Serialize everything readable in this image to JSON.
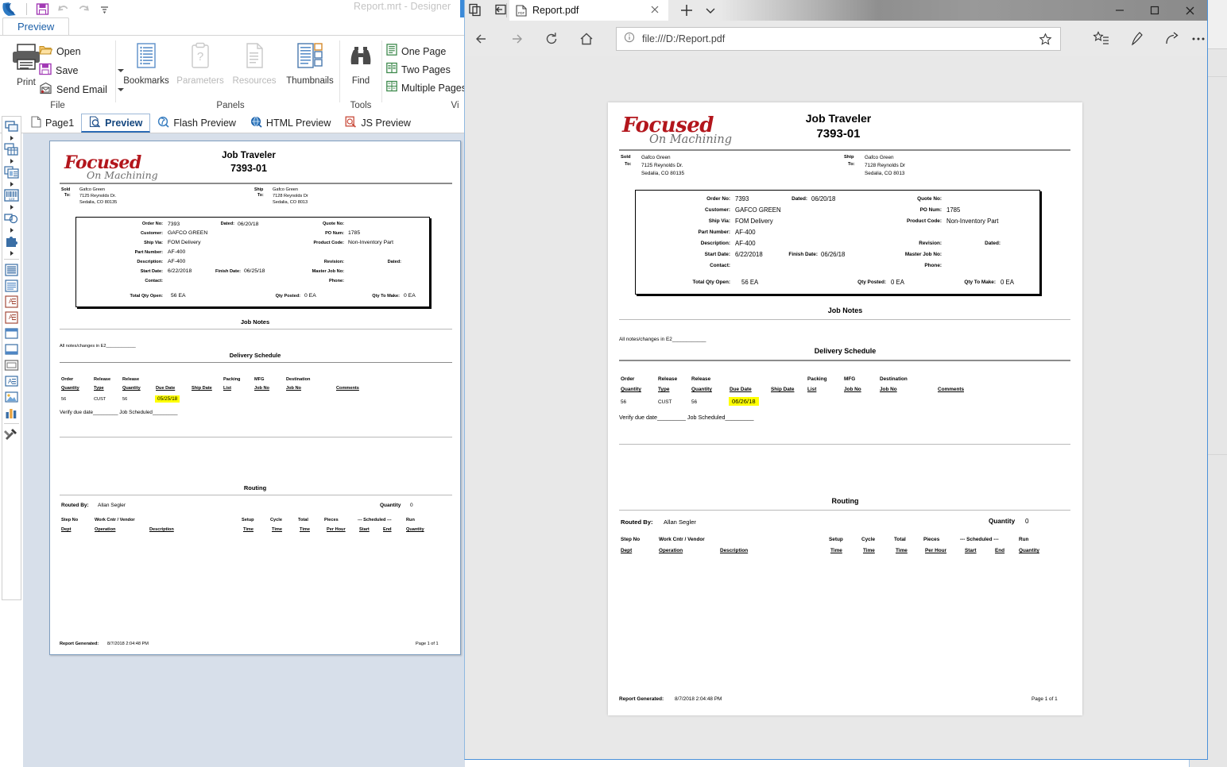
{
  "designer": {
    "window_title": "Report.mrt  - Designer",
    "quick_access": [
      {
        "name": "app-logo",
        "icon": "stimulsoft-logo"
      },
      {
        "name": "save",
        "icon": "save-icon"
      },
      {
        "name": "undo",
        "icon": "undo-icon"
      },
      {
        "name": "redo",
        "icon": "redo-icon"
      },
      {
        "name": "customize",
        "icon": "chevron-down-icon"
      }
    ],
    "ribbon": {
      "active_tab": "Preview",
      "groups": [
        {
          "label": "File"
        },
        {
          "label": "Panels"
        },
        {
          "label": "Tools"
        },
        {
          "label": "Vi"
        }
      ],
      "file_group": {
        "print": "Print",
        "open": "Open",
        "save": "Save",
        "send_email": "Send Email"
      },
      "panels_group": {
        "bookmarks": "Bookmarks",
        "parameters": "Parameters",
        "resources": "Resources",
        "thumbnails": "Thumbnails"
      },
      "tools_group": {
        "find": "Find"
      },
      "view_group": {
        "one_page": "One Page",
        "two_pages": "Two Pages",
        "multiple_pages": "Multiple Pages"
      }
    },
    "view_tabs": [
      {
        "label": "Page1",
        "icon": "page-icon",
        "active": false
      },
      {
        "label": "Preview",
        "icon": "preview-icon",
        "active": true
      },
      {
        "label": "Flash Preview",
        "icon": "flash-preview-icon",
        "active": false
      },
      {
        "label": "HTML Preview",
        "icon": "html-preview-icon",
        "active": false
      },
      {
        "label": "JS Preview",
        "icon": "js-preview-icon",
        "active": false
      }
    ],
    "toolbox_items": [
      {
        "name": "panel-tool",
        "icon": "panel-icon",
        "has_arrow": true
      },
      {
        "name": "table-tool",
        "icon": "table-icon",
        "has_arrow": true
      },
      {
        "name": "cross-tab-tool",
        "icon": "cross-tab-icon",
        "has_arrow": true
      },
      {
        "name": "barcode-tool",
        "icon": "barcode-icon",
        "has_arrow": true
      },
      {
        "name": "shape-tool",
        "icon": "shape-icon",
        "has_arrow": true
      },
      {
        "name": "plugin-tool",
        "icon": "puzzle-icon",
        "has_arrow": true
      },
      {
        "name": "data-band-tool",
        "icon": "data-band-icon",
        "has_arrow": false
      },
      {
        "name": "text-band-tool",
        "icon": "lines-icon",
        "has_arrow": false
      },
      {
        "name": "header-band-tool",
        "icon": "header-band-icon",
        "has_arrow": false
      },
      {
        "name": "footer-band-tool",
        "icon": "footer-band-icon",
        "has_arrow": false
      },
      {
        "name": "page-header-tool",
        "icon": "page-header-icon",
        "has_arrow": false
      },
      {
        "name": "page-footer-tool",
        "icon": "page-footer-icon",
        "has_arrow": false
      },
      {
        "name": "text-box-tool",
        "icon": "textbox-icon",
        "has_arrow": false
      },
      {
        "name": "rich-text-tool",
        "icon": "richtext-icon",
        "has_arrow": false
      },
      {
        "name": "image-tool",
        "icon": "image-icon",
        "has_arrow": false
      },
      {
        "name": "chart-tool",
        "icon": "chart-icon",
        "has_arrow": false
      },
      {
        "name": "options-tool",
        "icon": "tools-icon",
        "has_arrow": false
      }
    ]
  },
  "browser": {
    "left_icons": [
      {
        "name": "set-tabs-aside",
        "icon": "tabs-aside-icon"
      },
      {
        "name": "tabs-you-set-aside",
        "icon": "tabs-restore-icon"
      }
    ],
    "tab": {
      "title": "Report.pdf",
      "favicon": "pdf-icon",
      "close": "✕"
    },
    "new_tab": "+",
    "tab_menu": "⌄",
    "window_controls": {
      "minimize": "─",
      "maximize": "☐",
      "close": "✕"
    },
    "nav": {
      "back": "←",
      "forward": "→",
      "refresh": "↻",
      "home": "⌂"
    },
    "address": {
      "info_icon": "info-icon",
      "url": "file:///D:/Report.pdf",
      "favorite_icon": "star-icon"
    },
    "toolbar_right": [
      {
        "name": "favorites-hub",
        "icon": "favorites-star-list-icon"
      },
      {
        "name": "make-a-note",
        "icon": "pen-icon"
      },
      {
        "name": "share",
        "icon": "share-icon"
      },
      {
        "name": "settings-and-more",
        "icon": "ellipsis-icon"
      }
    ]
  },
  "report_pdf": {
    "logo": {
      "line1": "Focused",
      "line2": "On Machining"
    },
    "title": "Job Traveler",
    "subtitle": "7393-01",
    "sold_to": {
      "label1": "Sold",
      "label2": "To:",
      "lines": [
        "Gafco Green",
        "7125 Reynolds Dr.",
        "Sedalia, CO 80135"
      ]
    },
    "ship_to": {
      "label1": "Ship",
      "label2": "To:",
      "lines": [
        "Gafco Green",
        "7128 Reynolds Dr",
        "Sedalia, CO 8013"
      ]
    },
    "order_box": {
      "order_no_label": "Order No:",
      "order_no": "7393",
      "dated_label": "Dated:",
      "dated": "06/20/18",
      "quote_no_label": "Quote No:",
      "quote_no": "",
      "customer_label": "Customer:",
      "customer": "GAFCO GREEN",
      "po_num_label": "PO Num:",
      "po_num": "1785",
      "ship_via_label": "Ship Via:",
      "ship_via": "FOM Delivery",
      "product_code_label": "Product Code:",
      "product_code": "Non-Inventory Part",
      "part_number_label": "Part Number:",
      "part_number": "AF-400",
      "description_label": "Description:",
      "description": "AF-400",
      "revision_label": "Revision:",
      "revision": "",
      "revision_dated_label": "Dated:",
      "revision_dated": "",
      "start_date_label": "Start Date:",
      "start_date": "6/22/2018",
      "finish_date_label": "Finish Date:",
      "finish_date": "06/26/18",
      "master_job_no_label": "Master Job No:",
      "master_job_no": "",
      "contact_label": "Contact:",
      "contact": "",
      "phone_label": "Phone:",
      "phone": "",
      "total_qty_open_label": "Total Qty Open:",
      "total_qty_open": "56  EA",
      "qty_posted_label": "Qty Posted:",
      "qty_posted": "0  EA",
      "qty_to_make_label": "Qty To Make:",
      "qty_to_make": "0  EA"
    },
    "job_notes": {
      "heading": "Job Notes",
      "text": "All notes/changes in E2____________"
    },
    "delivery_schedule": {
      "heading": "Delivery Schedule",
      "columns_top": [
        "Order",
        "Release",
        "Release",
        "",
        "",
        "Packing",
        "MFG",
        "Destination",
        ""
      ],
      "columns_bot": [
        "Quantity",
        "Type",
        "Quantity",
        "Due Date",
        "Ship Date",
        "List",
        "Job No",
        "Job No",
        "Comments"
      ],
      "row": {
        "order_quantity": "56",
        "release_type": "CUST",
        "release_quantity": "56",
        "due_date": "06/26/18",
        "ship_date": "",
        "packing_list": "",
        "mfg_job_no": "",
        "destination_job_no": "",
        "comments": ""
      },
      "verify_text": "Verify due date_________  Job Scheduled_________"
    },
    "routing": {
      "heading": "Routing",
      "routed_by_label": "Routed By:",
      "routed_by": "Allan Segler",
      "quantity_label": "Quantity",
      "quantity": "0",
      "columns_top": [
        "Step No",
        "Work Cntr / Vendor",
        "",
        "Setup",
        "Cycle",
        "Total",
        "Pieces",
        "--- Scheduled ---",
        "",
        "Run"
      ],
      "columns_bot": [
        "Dept",
        "Operation",
        "Description",
        "Time",
        "Time",
        "Time",
        "Per Hour",
        "Start",
        "End",
        "Quantity"
      ]
    },
    "footer": {
      "generated_label": "Report Generated:",
      "generated_value": "8/7/2018 2:04:48 PM",
      "page": "Page 1 of 1"
    }
  },
  "report_preview": {
    "logo": {
      "line1": "Focused",
      "line2": "On Machining"
    },
    "title": "Job Traveler",
    "subtitle": "7393-01",
    "sold_to": {
      "label1": "Sold",
      "label2": "To:",
      "lines": [
        "Gafco Green",
        "7125 Reynolds Dr.",
        "Sedalia, CO 80135"
      ]
    },
    "ship_to": {
      "label1": "Ship",
      "label2": "To:",
      "lines": [
        "Gafco Green",
        "7128 Reynolds Dr",
        "Sedalia, CO 8013"
      ]
    },
    "order_box": {
      "order_no_label": "Order No:",
      "order_no": "7393",
      "dated_label": "Dated:",
      "dated": "06/20/18",
      "quote_no_label": "Quote No:",
      "quote_no": "",
      "customer_label": "Customer:",
      "customer": "GAFCO GREEN",
      "po_num_label": "PO Num:",
      "po_num": "1785",
      "ship_via_label": "Ship Via:",
      "ship_via": "FOM Delivery",
      "product_code_label": "Product Code:",
      "product_code": "Non-Inventory Part",
      "part_number_label": "Part Number:",
      "part_number": "AF-400",
      "description_label": "Description:",
      "description": "AF-400",
      "revision_label": "Revision:",
      "revision": "",
      "revision_dated_label": "Dated:",
      "revision_dated": "",
      "start_date_label": "Start Date:",
      "start_date": "6/22/2018",
      "finish_date_label": "Finish Date:",
      "finish_date": "06/25/18",
      "master_job_no_label": "Master Job No:",
      "master_job_no": "",
      "contact_label": "Contact:",
      "contact": "",
      "phone_label": "Phone:",
      "phone": "",
      "total_qty_open_label": "Total Qty Open:",
      "total_qty_open": "56 EA",
      "qty_posted_label": "Qty Posted:",
      "qty_posted": "0 EA",
      "qty_to_make_label": "Qty To Make:",
      "qty_to_make": "0 EA"
    },
    "job_notes": {
      "heading": "Job Notes",
      "text": "All notes/changes in E2____________"
    },
    "delivery_schedule": {
      "heading": "Delivery Schedule",
      "columns_bot": [
        "Quantity",
        "Type",
        "Quantity",
        "Due Date",
        "Ship Date",
        "List",
        "Job No",
        "Job No",
        "Comments"
      ],
      "columns_top": [
        "Order",
        "Release",
        "Release",
        "",
        "",
        "Packing",
        "MFG",
        "Destination",
        ""
      ],
      "row": {
        "order_quantity": "56",
        "release_type": "CUST",
        "release_quantity": "56",
        "due_date": "05/25/18"
      },
      "verify_text": "Verify due date_________  Job Scheduled_________"
    },
    "routing": {
      "heading": "Routing",
      "routed_by_label": "Routed By:",
      "routed_by": "Allan Segler",
      "quantity_label": "Quantity",
      "quantity": "0",
      "columns_top": [
        "Step No",
        "Work Cntr / Vendor",
        "",
        "Setup",
        "Cycle",
        "Total",
        "Pieces",
        "--- Scheduled ---",
        "",
        "Run"
      ],
      "columns_bot": [
        "Dept",
        "Operation",
        "Description",
        "Time",
        "Time",
        "Time",
        "Per Hour",
        "Start",
        "End",
        "Quantity"
      ]
    },
    "footer": {
      "generated_label": "Report Generated:",
      "generated_value": "8/7/2018 2:04:48 PM",
      "page": "Page 1 of 1"
    }
  },
  "colors": {
    "logo_red": "#b3161c",
    "logo_gray": "#6e6e6e",
    "highlight_yellow": "#ffff00",
    "accent_blue": "#2a6ab5",
    "edge_border": "#4a90d9",
    "preview_bg": "#d7dfea",
    "browser_bg": "#e8e8e8"
  }
}
